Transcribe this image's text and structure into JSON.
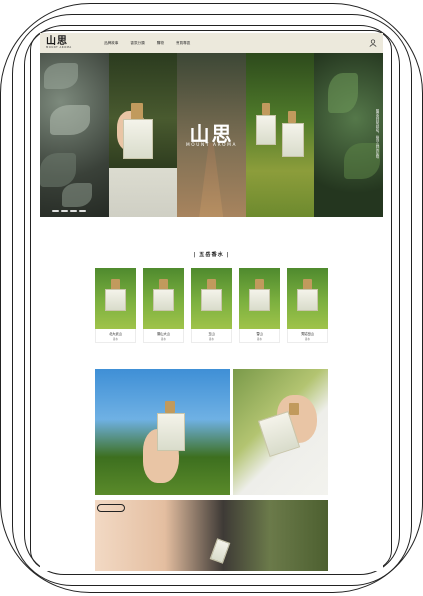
{
  "header": {
    "logo_mark": "山思",
    "logo_sub": "MOUNT AROMA",
    "nav": [
      "品牌故事",
      "香氛分類",
      "購物",
      "會員專區"
    ]
  },
  "hero": {
    "logo_mark": "山思",
    "logo_sub": "MOUNT AROMA",
    "side_text": "聽見森林的呼吸，嗅到山林的氣味"
  },
  "products": {
    "title": "| 五岳香水 |",
    "items": [
      {
        "name": "北大武山",
        "type": "香水"
      },
      {
        "name": "關山大山",
        "type": "香水"
      },
      {
        "name": "玉山",
        "type": "香水"
      },
      {
        "name": "雪山",
        "type": "香水"
      },
      {
        "name": "秀姑巒山",
        "type": "香水"
      }
    ]
  },
  "icons": {
    "user": "user-icon"
  }
}
